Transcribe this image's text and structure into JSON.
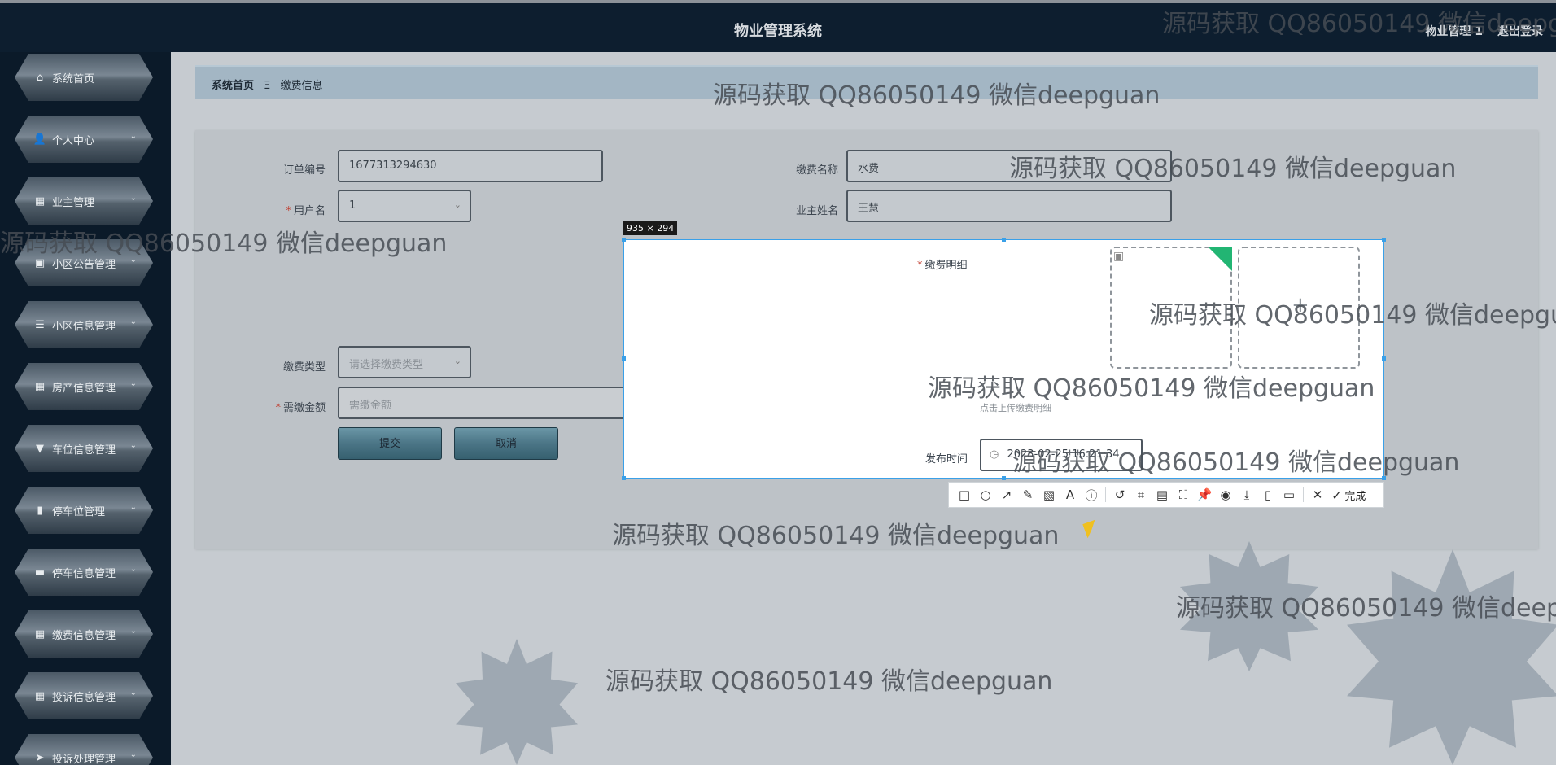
{
  "app": {
    "title": "物业管理系统",
    "user": "物业管理 1",
    "logout": "退出登录"
  },
  "sidebar": {
    "items": [
      {
        "label": "系统首页",
        "icon": "home-icon",
        "glyph": "⌂",
        "chevron": false
      },
      {
        "label": "个人中心",
        "icon": "user-icon",
        "glyph": "👤",
        "chevron": true
      },
      {
        "label": "业主管理",
        "icon": "grid-icon",
        "glyph": "▦",
        "chevron": true
      },
      {
        "label": "小区公告管理",
        "icon": "notice-icon",
        "glyph": "▣",
        "chevron": true
      },
      {
        "label": "小区信息管理",
        "icon": "list-icon",
        "glyph": "☰",
        "chevron": true
      },
      {
        "label": "房产信息管理",
        "icon": "grid-icon",
        "glyph": "▦",
        "chevron": true
      },
      {
        "label": "车位信息管理",
        "icon": "parking-icon",
        "glyph": "▼",
        "chevron": true
      },
      {
        "label": "停车位管理",
        "icon": "bar-chart-icon",
        "glyph": "▮",
        "chevron": true
      },
      {
        "label": "停车信息管理",
        "icon": "ticket-icon",
        "glyph": "▬",
        "chevron": true
      },
      {
        "label": "缴费信息管理",
        "icon": "grid-icon",
        "glyph": "▦",
        "chevron": true
      },
      {
        "label": "投诉信息管理",
        "icon": "grid-icon",
        "glyph": "▦",
        "chevron": true
      },
      {
        "label": "投诉处理管理",
        "icon": "send-icon",
        "glyph": "➤",
        "chevron": true
      }
    ]
  },
  "breadcrumb": {
    "home": "系统首页",
    "separator": "Ξ",
    "current": "缴费信息"
  },
  "form": {
    "order_no_label": "订单编号",
    "order_no_value": "1677313294630",
    "fee_name_label": "缴费名称",
    "fee_name_value": "水费",
    "username_label": "用户名",
    "username_value": "1",
    "owner_name_label": "业主姓名",
    "owner_name_value": "王慧",
    "fee_detail_label": "缴费明细",
    "upload_hint": "点击上传缴费明细",
    "fee_type_label": "缴费类型",
    "fee_type_placeholder": "请选择缴费类型",
    "amount_label": "需缴金额",
    "amount_placeholder": "需缴金额",
    "publish_time_label": "发布时间",
    "publish_time_value": "2023-02-25 16:21:34",
    "submit": "提交",
    "cancel": "取消"
  },
  "capture": {
    "size_label": "935 × 294",
    "done": "完成",
    "tools": [
      "rectangle-icon",
      "ellipse-icon",
      "arrow-icon",
      "pen-icon",
      "mosaic-icon",
      "text-icon",
      "number-icon",
      "undo-icon",
      "ocr-icon",
      "translate-icon",
      "scan-icon",
      "pin-icon",
      "record-icon",
      "download-icon",
      "save-icon",
      "bookmark-icon"
    ],
    "tool_glyphs": [
      "□",
      "○",
      "↗",
      "✎",
      "▧",
      "A",
      "ⓘ",
      "↺",
      "⌗",
      "▤",
      "⛶",
      "📌",
      "◉",
      "⤓",
      "▯",
      "▭"
    ]
  },
  "watermark": "源码获取 QQ86050149 微信deepguan",
  "colors": {
    "topbar": "#0d1e2f",
    "selection_border": "#3aa0e8",
    "upload_corner": "#22b573"
  }
}
